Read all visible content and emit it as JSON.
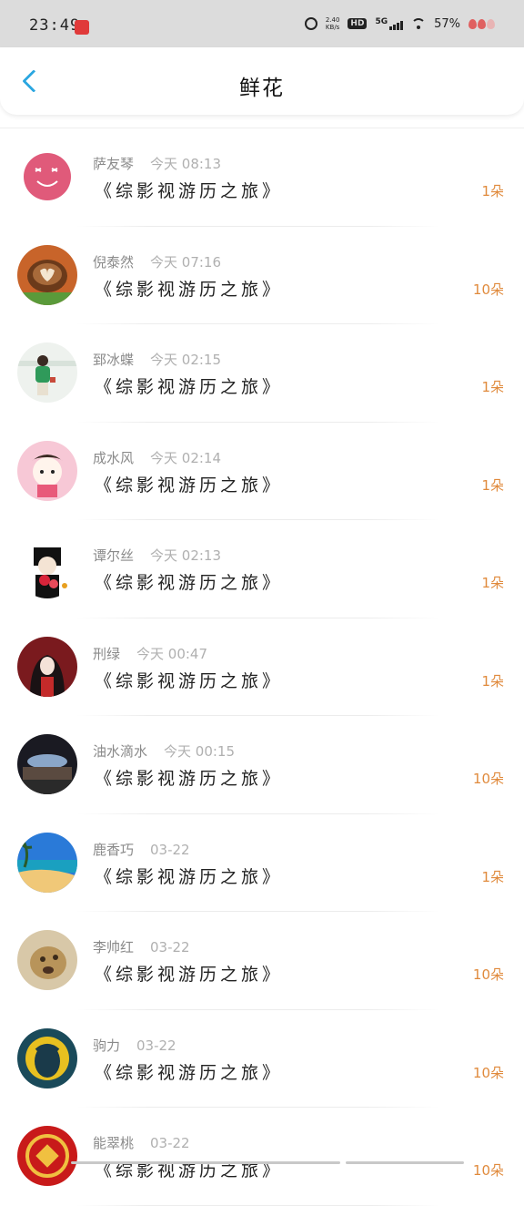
{
  "status_bar": {
    "time": "23:49",
    "net_speed_top": "2.40",
    "net_speed_bottom": "KB/s",
    "hd": "HD",
    "signal": "5G",
    "battery": "57%"
  },
  "header": {
    "title": "鲜花"
  },
  "items": [
    {
      "name": "萨友琴",
      "time": "今天 08:13",
      "book": "《综影视游历之旅》",
      "count": "1朵"
    },
    {
      "name": "倪泰然",
      "time": "今天 07:16",
      "book": "《综影视游历之旅》",
      "count": "10朵"
    },
    {
      "name": "郅冰蝶",
      "time": "今天 02:15",
      "book": "《综影视游历之旅》",
      "count": "1朵"
    },
    {
      "name": "成水风",
      "time": "今天 02:14",
      "book": "《综影视游历之旅》",
      "count": "1朵"
    },
    {
      "name": "谭尔丝",
      "time": "今天 02:13",
      "book": "《综影视游历之旅》",
      "count": "1朵"
    },
    {
      "name": "刑绿",
      "time": "今天 00:47",
      "book": "《综影视游历之旅》",
      "count": "1朵"
    },
    {
      "name": "油水滴水",
      "time": "今天 00:15",
      "book": "《综影视游历之旅》",
      "count": "10朵"
    },
    {
      "name": "鹿香巧",
      "time": "03-22",
      "book": "《综影视游历之旅》",
      "count": "1朵"
    },
    {
      "name": "李帅红",
      "time": "03-22",
      "book": "《综影视游历之旅》",
      "count": "10朵"
    },
    {
      "name": "驹力",
      "time": "03-22",
      "book": "《综影视游历之旅》",
      "count": "10朵"
    },
    {
      "name": "能翠桃",
      "time": "03-22",
      "book": "《综影视游历之旅》",
      "count": "10朵"
    }
  ]
}
